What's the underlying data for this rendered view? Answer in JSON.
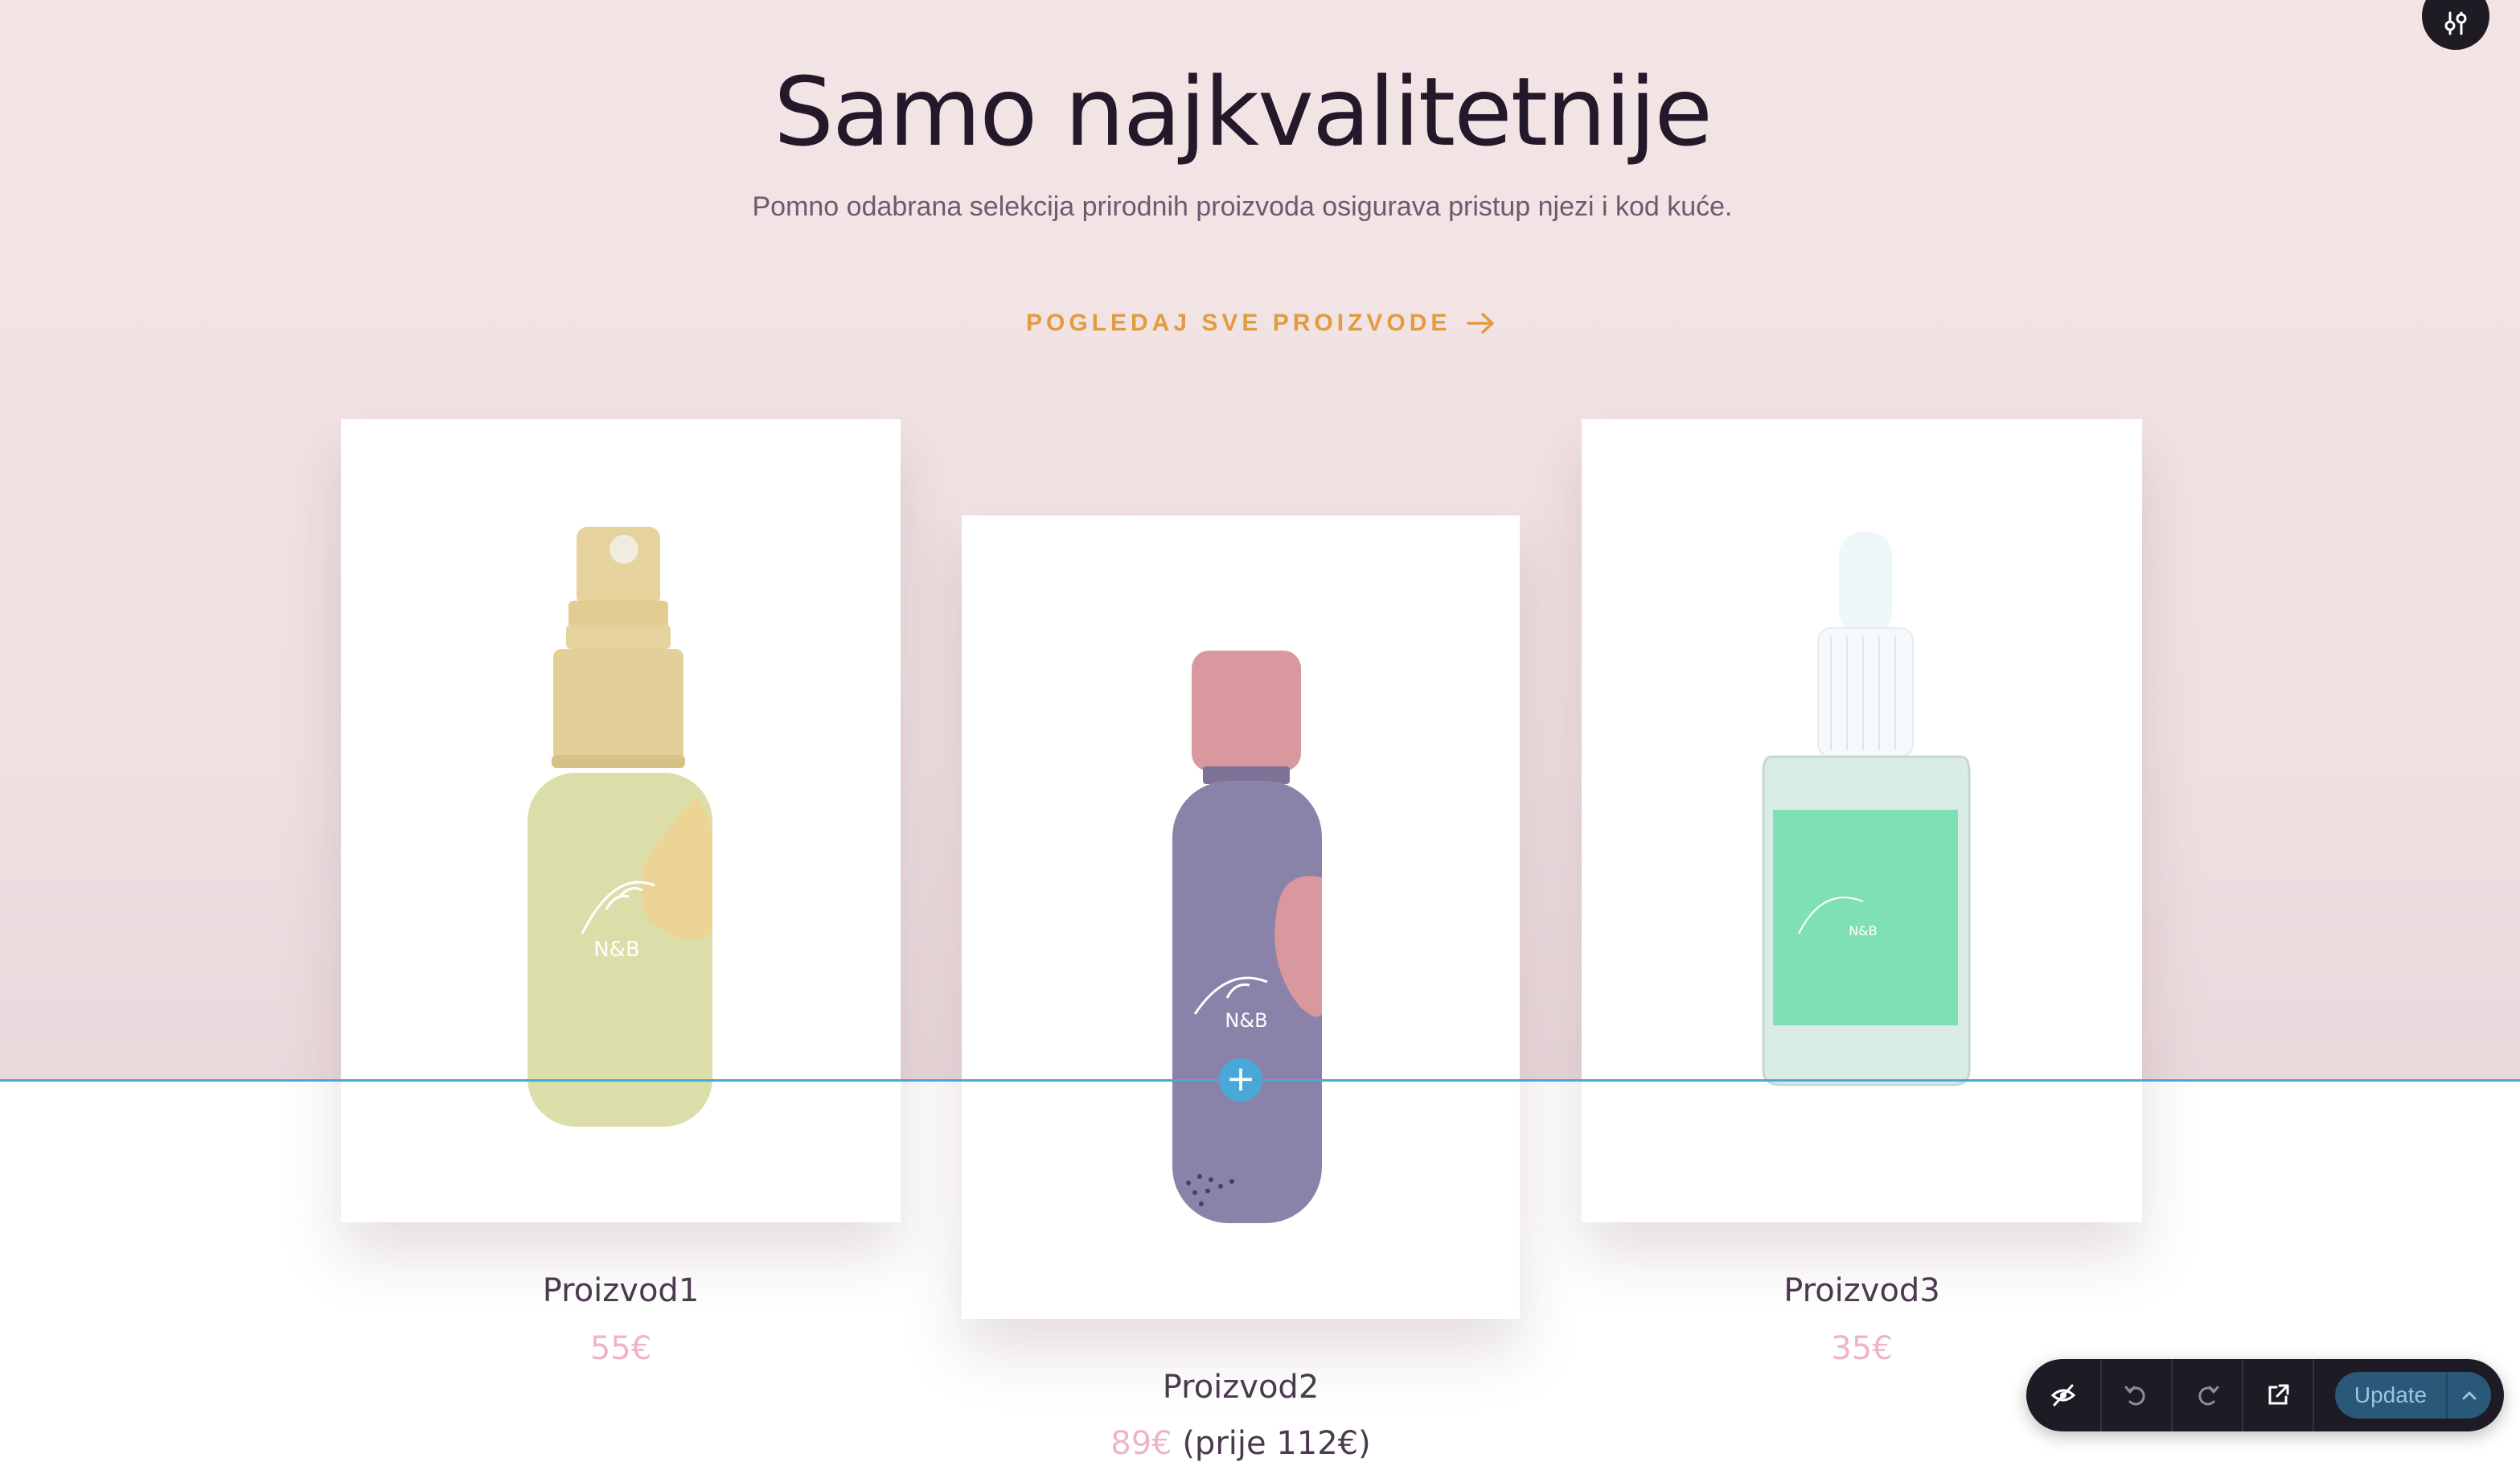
{
  "section": {
    "title": "Samo najkvalitetnije",
    "subtitle": "Pomno odabrana selekcija prirodnih proizvoda osigurava pristup njezi i kod kuće.",
    "cta_label": "POGLEDAJ SVE PROIZVODE"
  },
  "products": [
    {
      "name": "Proizvod1",
      "price": "55€",
      "brand": "N&B"
    },
    {
      "name": "Proizvod2",
      "price": "89€",
      "old_price": "(prije 112€)",
      "brand": "N&B"
    },
    {
      "name": "Proizvod3",
      "price": "35€",
      "brand": "N&B"
    }
  ],
  "editor": {
    "update_label": "Update",
    "add_section_symbol": "+"
  },
  "colors": {
    "accent": "#e29b3e",
    "price": "#efb5c4",
    "guide": "#4aa8d8",
    "toolbar": "#1f1b24"
  }
}
